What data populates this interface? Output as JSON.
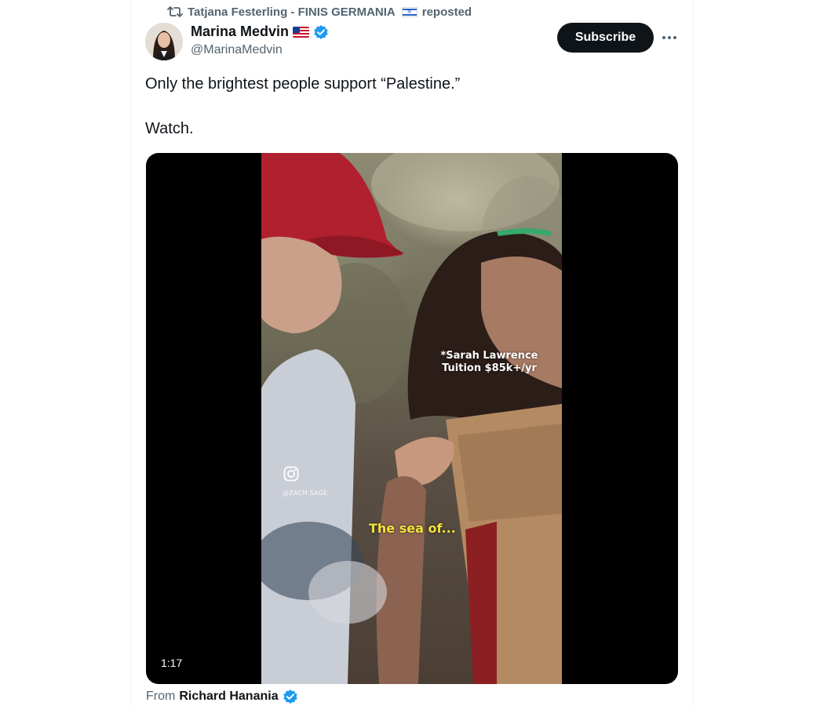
{
  "repost": {
    "icon": "repost-icon",
    "user_name": "Tatjana Festerling - FINIS GERMANIA",
    "flag": "israel-flag",
    "action": "reposted"
  },
  "author": {
    "name": "Marina Medvin",
    "flag": "us-flag",
    "handle": "@MarinaMedvin",
    "verified": true
  },
  "actions": {
    "subscribe_label": "Subscribe",
    "more_icon": "more-icon"
  },
  "tweet": {
    "line1": "Only the brightest people support “Palestine.”",
    "line2": "Watch."
  },
  "video": {
    "caption_top_line1": "*Sarah Lawrence",
    "caption_top_line2": "Tuition $85k+/yr",
    "caption_bottom": "The sea of...",
    "watermark_handle": "@ZACH.SAGE",
    "duration": "1:17"
  },
  "source": {
    "prefix": "From",
    "name": "Richard Hanania",
    "verified": true
  },
  "colors": {
    "text_primary": "#0f1419",
    "text_secondary": "#536471",
    "verified_blue": "#1d9bf0",
    "subscribe_bg": "#0f1419",
    "caption_yellow": "#f2e23a"
  }
}
